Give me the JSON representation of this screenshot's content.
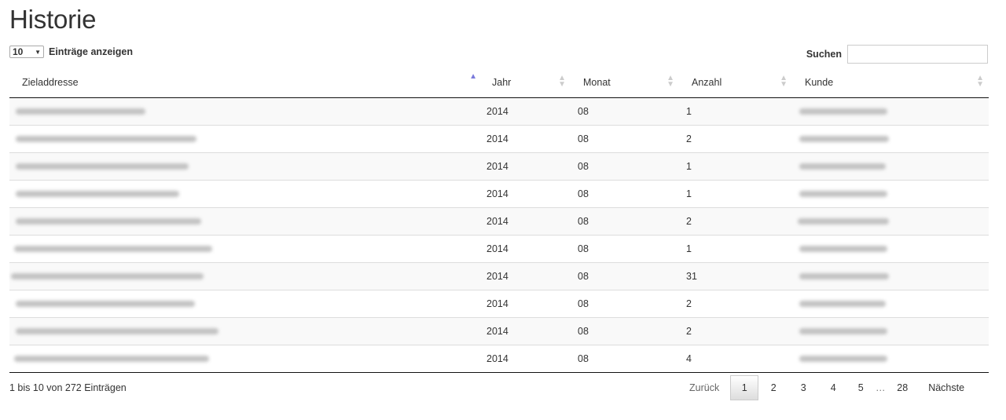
{
  "page": {
    "title": "Historie"
  },
  "controls": {
    "length_value": "10",
    "length_suffix": "Einträge anzeigen",
    "search_label": "Suchen",
    "search_value": ""
  },
  "table": {
    "headers": [
      "Zieladdresse",
      "Jahr",
      "Monat",
      "Anzahl",
      "Kunde"
    ],
    "rows": [
      {
        "jahr": "2014",
        "monat": "08",
        "anzahl": "1"
      },
      {
        "jahr": "2014",
        "monat": "08",
        "anzahl": "2"
      },
      {
        "jahr": "2014",
        "monat": "08",
        "anzahl": "1"
      },
      {
        "jahr": "2014",
        "monat": "08",
        "anzahl": "1"
      },
      {
        "jahr": "2014",
        "monat": "08",
        "anzahl": "2"
      },
      {
        "jahr": "2014",
        "monat": "08",
        "anzahl": "1"
      },
      {
        "jahr": "2014",
        "monat": "08",
        "anzahl": "31"
      },
      {
        "jahr": "2014",
        "monat": "08",
        "anzahl": "2"
      },
      {
        "jahr": "2014",
        "monat": "08",
        "anzahl": "2"
      },
      {
        "jahr": "2014",
        "monat": "08",
        "anzahl": "4"
      }
    ]
  },
  "footer": {
    "info": "1 bis 10 von 272 Einträgen",
    "pagination": {
      "prev": "Zurück",
      "pages": [
        "1",
        "2",
        "3",
        "4",
        "5"
      ],
      "ellipsis": "…",
      "last": "28",
      "next": "Nächste"
    }
  }
}
